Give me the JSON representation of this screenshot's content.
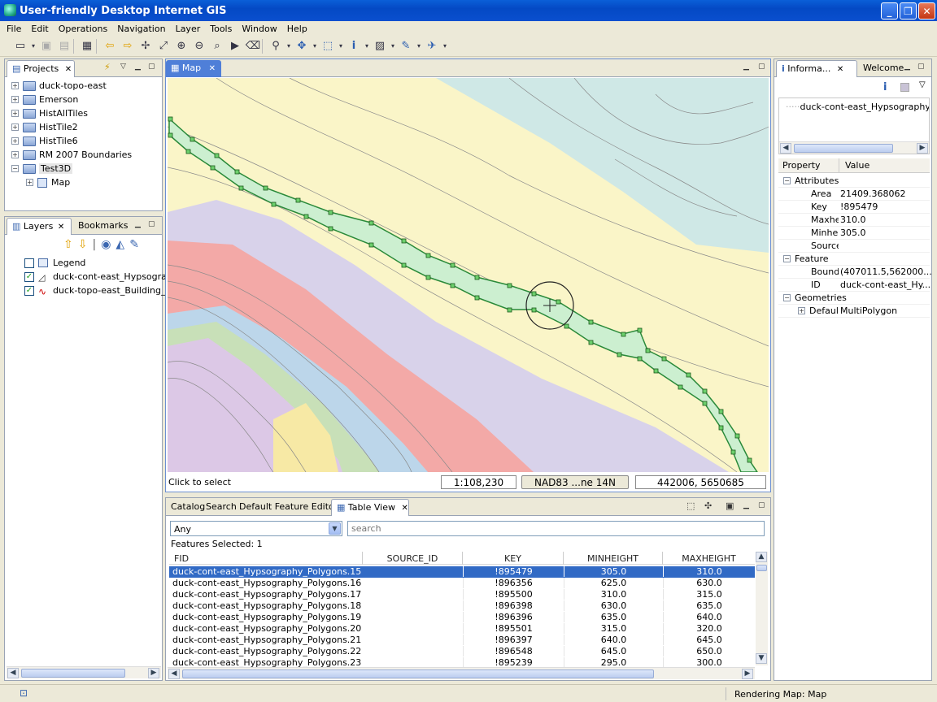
{
  "window": {
    "title": "User-friendly Desktop Internet GIS",
    "buttons": [
      "_",
      "❐",
      "✕"
    ]
  },
  "menu": [
    "File",
    "Edit",
    "Operations",
    "Navigation",
    "Layer",
    "Tools",
    "Window",
    "Help"
  ],
  "toolbar_icons": [
    "new-icon",
    "save-icon",
    "save-all-icon",
    "import-icon",
    "back-icon",
    "forward-icon",
    "zoom-extent-icon",
    "full-extent-icon",
    "zoom-in-icon",
    "zoom-out-icon",
    "zoom-box-icon",
    "pan-next-icon",
    "eraser-icon",
    "magnify-icon",
    "move-icon",
    "select-icon",
    "info-icon",
    "layer-style-icon",
    "edit-geometry-icon",
    "tools-icon"
  ],
  "projects": {
    "tab_label": "Projects",
    "items": [
      "duck-topo-east",
      "Emerson",
      "HistAllTiles",
      "HistTile2",
      "HistTile6",
      "RM 2007 Boundaries",
      "Test3D"
    ],
    "child": "Map"
  },
  "layers": {
    "tab_label": "Layers",
    "bookmarks_label": "Bookmarks",
    "items": [
      "Legend",
      "duck-cont-east_Hypsograp",
      "duck-topo-east_Building_lin"
    ]
  },
  "map": {
    "tab_label": "Map",
    "status": "Click to select",
    "scale": "1:108,230",
    "crs": "NAD83 ...ne 14N",
    "coords": "442006, 5650685"
  },
  "info": {
    "tab_label": "Informa...",
    "welcome_label": "Welcome",
    "selected_feature": "duck-cont-east_Hypsography_Pol",
    "col_property": "Property",
    "col_value": "Value",
    "rows": [
      {
        "label": "Attributes",
        "value": "",
        "level": 0,
        "group": true
      },
      {
        "label": "Area",
        "value": "21409.368062",
        "level": 1
      },
      {
        "label": "Key",
        "value": "!895479",
        "level": 1
      },
      {
        "label": "Maxhe",
        "value": "310.0",
        "level": 1
      },
      {
        "label": "Minhei",
        "value": "305.0",
        "level": 1
      },
      {
        "label": "Source",
        "value": "",
        "level": 1
      },
      {
        "label": "Feature",
        "value": "",
        "level": 0,
        "group": true
      },
      {
        "label": "Bounds",
        "value": "(407011.5,562000...",
        "level": 1
      },
      {
        "label": "ID",
        "value": "duck-cont-east_Hy...",
        "level": 1
      },
      {
        "label": "Geometries",
        "value": "",
        "level": 0,
        "group": true
      },
      {
        "label": "Default",
        "value": "MultiPolygon",
        "level": 1,
        "expander": true
      }
    ]
  },
  "bottom_tabs": [
    "Catalog",
    "Search",
    "Default Feature Editor",
    "Table View"
  ],
  "table": {
    "filter_value": "Any",
    "search_placeholder": "search",
    "selected_text": "Features Selected: 1",
    "columns": [
      "FID",
      "SOURCE_ID",
      "KEY",
      "MINHEIGHT",
      "MAXHEIGHT"
    ],
    "rows": [
      [
        "duck-cont-east_Hypsography_Polygons.15",
        "",
        "!895479",
        "305.0",
        "310.0"
      ],
      [
        "duck-cont-east_Hypsography_Polygons.16",
        "",
        "!896356",
        "625.0",
        "630.0"
      ],
      [
        "duck-cont-east_Hypsography_Polygons.17",
        "",
        "!895500",
        "310.0",
        "315.0"
      ],
      [
        "duck-cont-east_Hypsography_Polygons.18",
        "",
        "!896398",
        "630.0",
        "635.0"
      ],
      [
        "duck-cont-east_Hypsography_Polygons.19",
        "",
        "!896396",
        "635.0",
        "640.0"
      ],
      [
        "duck-cont-east_Hypsography_Polygons.20",
        "",
        "!895501",
        "315.0",
        "320.0"
      ],
      [
        "duck-cont-east_Hypsography_Polygons.21",
        "",
        "!896397",
        "640.0",
        "645.0"
      ],
      [
        "duck-cont-east_Hypsography_Polygons.22",
        "",
        "!896548",
        "645.0",
        "650.0"
      ],
      [
        "duck-cont-east_Hypsography_Polygons.23",
        "",
        "!895239",
        "295.0",
        "300.0"
      ]
    ]
  },
  "statusbar": {
    "text": "Rendering Map: Map"
  }
}
